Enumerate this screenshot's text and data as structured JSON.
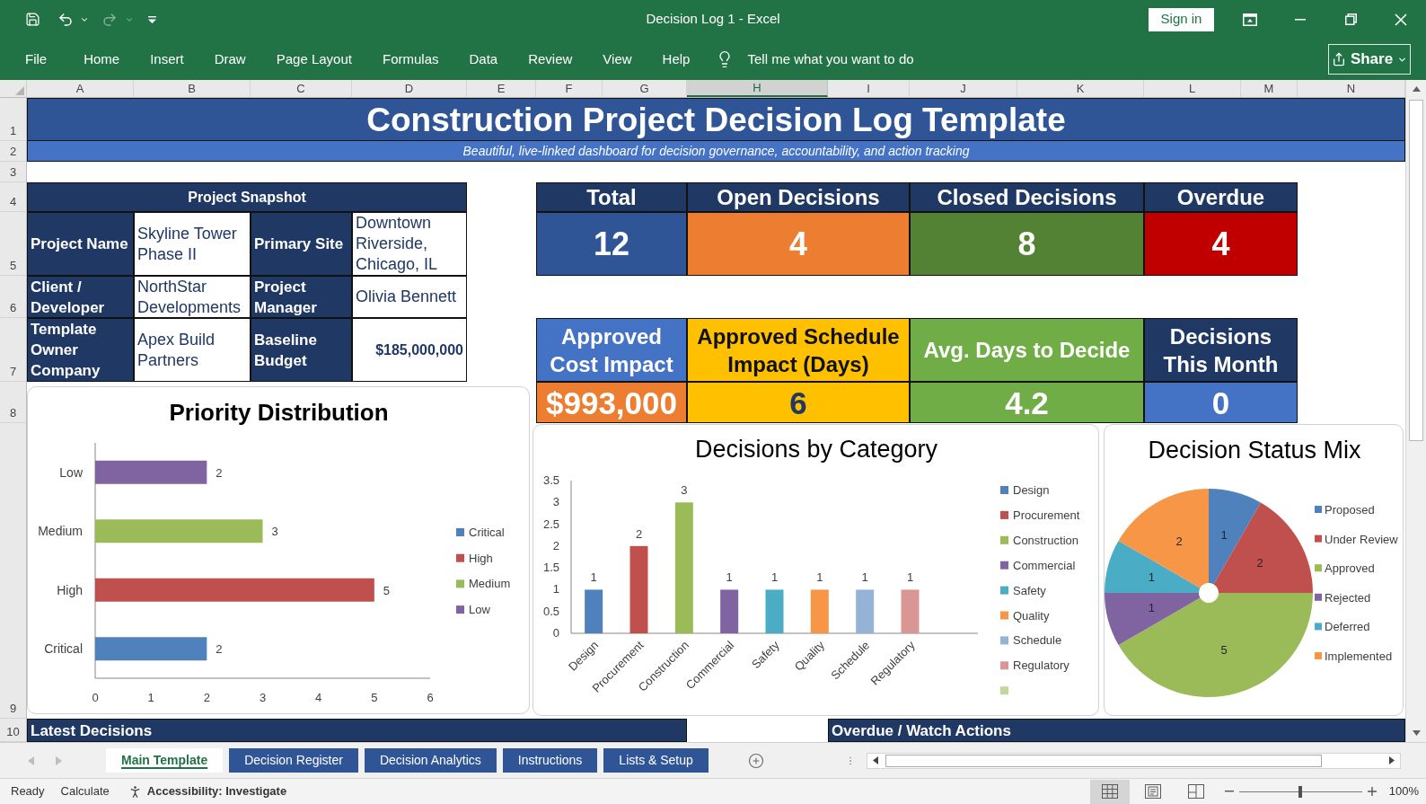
{
  "window": {
    "title": "Decision Log 1 - Excel",
    "sign_in": "Sign in"
  },
  "quick_access": {
    "redo_disabled": true
  },
  "ribbon": {
    "tabs": [
      "File",
      "Home",
      "Insert",
      "Draw",
      "Page Layout",
      "Formulas",
      "Data",
      "Review",
      "View",
      "Help"
    ],
    "tell_me": "Tell me what you want to do",
    "share": "Share"
  },
  "sheet": {
    "columns": [
      {
        "label": "A",
        "selected": false
      },
      {
        "label": "B",
        "selected": false
      },
      {
        "label": "C",
        "selected": false
      },
      {
        "label": "D",
        "selected": false
      },
      {
        "label": "E",
        "selected": false
      },
      {
        "label": "F",
        "selected": false
      },
      {
        "label": "G",
        "selected": false
      },
      {
        "label": "H",
        "selected": true
      },
      {
        "label": "I",
        "selected": false
      },
      {
        "label": "J",
        "selected": false
      },
      {
        "label": "K",
        "selected": false
      },
      {
        "label": "L",
        "selected": false
      },
      {
        "label": "M",
        "selected": false
      },
      {
        "label": "N",
        "selected": false
      }
    ],
    "rows": [
      "1",
      "2",
      "3",
      "4",
      "5",
      "6",
      "7",
      "8",
      "9",
      "10"
    ]
  },
  "title": "Construction Project Decision Log Template",
  "subtitle": "Beautiful, live-linked dashboard for decision governance, accountability, and action tracking",
  "snapshot": {
    "title": "Project Snapshot",
    "rows": [
      {
        "fields": [
          {
            "kind": "text",
            "label": "Project Name",
            "value": "Skyline Tower Phase II"
          },
          {
            "kind": "text",
            "label": "Primary Site",
            "value": "Downtown Riverside, Chicago, IL"
          }
        ]
      },
      {
        "fields": [
          {
            "kind": "text",
            "label": "Client / Developer",
            "value": "NorthStar Developments"
          },
          {
            "kind": "text",
            "label": "Project Manager",
            "value": "Olivia Bennett"
          }
        ]
      },
      {
        "fields": [
          {
            "kind": "text",
            "label": "Template Owner Company",
            "value": "Apex Build Partners"
          },
          {
            "kind": "currency",
            "label": "Baseline Budget",
            "value": "$185,000,000"
          }
        ]
      }
    ]
  },
  "kpis": [
    {
      "label": "Total",
      "value": "12",
      "color": "#2f5597"
    },
    {
      "label": "Open Decisions",
      "value": "4",
      "color": "#ed7d31"
    },
    {
      "label": "Closed Decisions",
      "value": "8",
      "color": "#548235"
    },
    {
      "label": "Overdue",
      "value": "4",
      "color": "#c00000"
    }
  ],
  "impact_kpis": [
    {
      "label": {
        "text": "Approved Cost Impact",
        "color": "#4472c4"
      },
      "value": {
        "text": "$993,000",
        "color": "#ed7d31"
      }
    },
    {
      "label": {
        "text": "Approved Schedule Impact (Days)",
        "color": "#ffc000"
      },
      "value": {
        "text": "6",
        "color": "#ffc000"
      }
    },
    {
      "label": {
        "text": "Avg. Days to Decide",
        "color": "#70ad47"
      },
      "value": {
        "text": "4.2",
        "color": "#70ad47"
      }
    },
    {
      "label": {
        "text": "Decisions This Month",
        "color": "#1f3864"
      },
      "value": {
        "text": "0",
        "color": "#4472c4"
      }
    }
  ],
  "priority_chart": {
    "chart_data": {
      "type": "bar",
      "orientation": "horizontal",
      "stacked": true,
      "title": "Priority Distribution",
      "categories": [
        "Low",
        "Medium",
        "High",
        "Critical"
      ],
      "series": [
        {
          "name": "Critical",
          "color": "#4f81bd",
          "values": [
            null,
            null,
            null,
            2
          ]
        },
        {
          "name": "High",
          "color": "#c0504d",
          "values": [
            null,
            null,
            5,
            null
          ]
        },
        {
          "name": "Medium",
          "color": "#9bbb59",
          "values": [
            null,
            3,
            null,
            null
          ]
        },
        {
          "name": "Low",
          "color": "#8064a2",
          "values": [
            2,
            null,
            null,
            null
          ]
        }
      ],
      "xlim": [
        0,
        6
      ],
      "xticks": [
        0,
        1,
        2,
        3,
        4,
        5,
        6
      ],
      "data_labels": true,
      "legend": "right"
    }
  },
  "category_chart": {
    "chart_data": {
      "type": "bar",
      "stacked": true,
      "title": "Decisions by Category",
      "categories": [
        "Design",
        "Procurement",
        "Construction",
        "Commercial",
        "Safety",
        "Quality",
        "Schedule",
        "Regulatory",
        null
      ],
      "series": [
        {
          "name": "Design",
          "color": "#4f81bd",
          "values": [
            1,
            null,
            null,
            null,
            null,
            null,
            null,
            null,
            null
          ]
        },
        {
          "name": "Procurement",
          "color": "#c0504d",
          "values": [
            null,
            2,
            null,
            null,
            null,
            null,
            null,
            null,
            null
          ]
        },
        {
          "name": "Construction",
          "color": "#9bbb59",
          "values": [
            null,
            null,
            3,
            null,
            null,
            null,
            null,
            null,
            null
          ]
        },
        {
          "name": "Commercial",
          "color": "#8064a2",
          "values": [
            null,
            null,
            null,
            1,
            null,
            null,
            null,
            null,
            null
          ]
        },
        {
          "name": "Safety",
          "color": "#4bacc6",
          "values": [
            null,
            null,
            null,
            null,
            1,
            null,
            null,
            null,
            null
          ]
        },
        {
          "name": "Quality",
          "color": "#f79646",
          "values": [
            null,
            null,
            null,
            null,
            null,
            1,
            null,
            null,
            null
          ]
        },
        {
          "name": "Schedule",
          "color": "#95b3d7",
          "values": [
            null,
            null,
            null,
            null,
            null,
            null,
            1,
            null,
            null
          ]
        },
        {
          "name": "Regulatory",
          "color": "#d99694",
          "values": [
            null,
            null,
            null,
            null,
            null,
            null,
            null,
            1,
            null
          ]
        },
        {
          "color": "#c3d69b",
          "values": [
            null,
            null,
            null,
            null,
            null,
            null,
            null,
            null,
            null
          ]
        }
      ],
      "ylim": [
        0,
        3.5
      ],
      "yticks": [
        0,
        0.5,
        1,
        1.5,
        2,
        2.5,
        3,
        3.5
      ],
      "data_labels": true,
      "legend": "right"
    }
  },
  "status_chart": {
    "chart_data": {
      "type": "pie",
      "title": "Decision Status Mix",
      "categories": [
        "Proposed",
        "Under Review",
        "Approved",
        "Rejected",
        "Deferred",
        "Implemented"
      ],
      "values": [
        1,
        2,
        5,
        1,
        1,
        2
      ],
      "colors": [
        "#4f81bd",
        "#c0504d",
        "#9bbb59",
        "#8064a2",
        "#4bacc6",
        "#f79646"
      ],
      "data_labels": true,
      "legend": "right"
    }
  },
  "latest_decisions": {
    "title": "Latest Decisions"
  },
  "overdue_actions": {
    "title": "Overdue / Watch Actions"
  },
  "sheet_tabs": {
    "scroll_disabled": true,
    "tabs": [
      {
        "label": "Main Template",
        "selected": true
      },
      {
        "label": "Decision Register",
        "selected": false
      },
      {
        "label": "Decision Analytics",
        "selected": false
      },
      {
        "label": "Instructions",
        "selected": false
      },
      {
        "label": "Lists & Setup",
        "selected": false
      }
    ]
  },
  "status_bar": {
    "mode": "Ready",
    "calculate": "Calculate",
    "accessibility": "Accessibility: Investigate",
    "views": [
      {
        "kind": "normal",
        "selected": true
      },
      {
        "kind": "page_layout",
        "selected": false
      },
      {
        "kind": "page_break",
        "selected": false
      }
    ],
    "zoom": {
      "level": 0.5,
      "label": "100%"
    }
  }
}
